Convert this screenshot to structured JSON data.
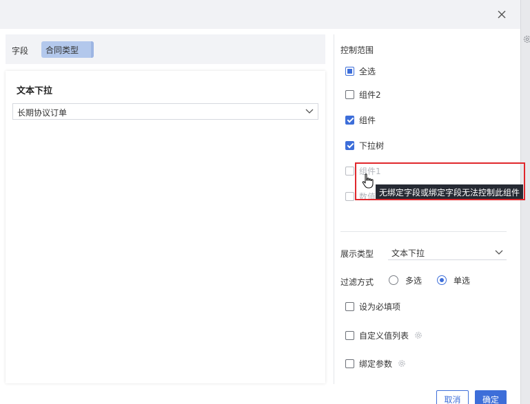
{
  "left": {
    "field_label": "字段",
    "field_chip": "合同类型",
    "preview_title": "文本下拉",
    "preview_value": "长期协议订单"
  },
  "right": {
    "control_range_title": "控制范围",
    "checkboxes": [
      {
        "label": "全选",
        "state": "indeterminate"
      },
      {
        "label": "组件2",
        "state": "unchecked"
      },
      {
        "label": "组件",
        "state": "checked"
      },
      {
        "label": "下拉树",
        "state": "checked"
      },
      {
        "label": "组件1",
        "state": "disabled"
      },
      {
        "label": "数值",
        "state": "disabled"
      }
    ],
    "display_type_label": "展示类型",
    "display_type_value": "文本下拉",
    "filter_mode_label": "过滤方式",
    "filter_options": [
      {
        "label": "多选",
        "selected": false
      },
      {
        "label": "单选",
        "selected": true
      }
    ],
    "options": [
      {
        "label": "设为必填项",
        "checked": false,
        "has_gear": false
      },
      {
        "label": "自定义值列表",
        "checked": false,
        "has_gear": true
      },
      {
        "label": "绑定参数",
        "checked": false,
        "has_gear": true
      }
    ],
    "cancel_label": "取消",
    "ok_label": "确定"
  },
  "tooltip": {
    "text": "无绑定字段或绑定字段无法控制此组件"
  },
  "colors": {
    "accent": "#3d6ed9",
    "highlight": "#e0262b",
    "tooltip_bg": "#262a33"
  }
}
